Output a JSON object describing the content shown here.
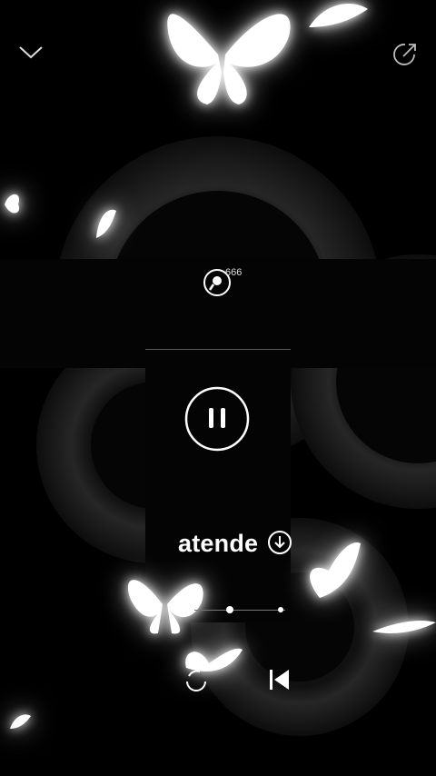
{
  "header": {
    "collapse_icon": "chevron-down-icon",
    "share_icon": "share-icon"
  },
  "mic": {
    "count": "666",
    "icon": "microphone-icon"
  },
  "player": {
    "play_state_icon": "pause-icon",
    "song_title": "atende",
    "download_icon": "download-icon",
    "progress": 0.3
  },
  "controls": {
    "repeat_icon": "repeat-icon",
    "previous_icon": "skip-previous-icon"
  },
  "colors": {
    "background": "#000000",
    "foreground": "#ffffff"
  }
}
